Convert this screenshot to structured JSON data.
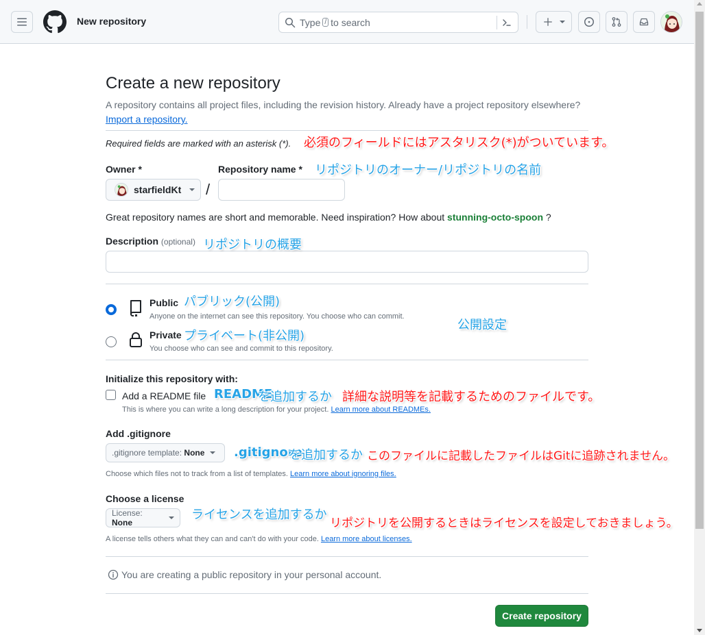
{
  "header": {
    "context_title": "New repository",
    "search_prefix": "Type",
    "search_key": "/",
    "search_suffix": "to search"
  },
  "page": {
    "title": "Create a new repository",
    "subtitle": "A repository contains all project files, including the revision history. Already have a project repository elsewhere?",
    "import_link": "Import a repository.",
    "required_note": "Required fields are marked with an asterisk (*)."
  },
  "owner": {
    "label": "Owner *",
    "value": "starfieldKt"
  },
  "repo_name": {
    "label": "Repository name *",
    "value": "",
    "placeholder": ""
  },
  "name_hint": {
    "text": "Great repository names are short and memorable. Need inspiration? How about",
    "suggestion": "stunning-octo-spoon",
    "suffix": "?"
  },
  "description": {
    "label": "Description",
    "optional": "(optional)",
    "value": ""
  },
  "visibility": {
    "public_title": "Public",
    "public_desc": "Anyone on the internet can see this repository. You choose who can commit.",
    "private_title": "Private",
    "private_desc": "You choose who can see and commit to this repository.",
    "selected": "public"
  },
  "init": {
    "heading": "Initialize this repository with:",
    "readme_label": "Add a README file",
    "readme_desc": "This is where you can write a long description for your project.",
    "readme_link": "Learn more about READMEs."
  },
  "gitignore": {
    "heading": "Add .gitignore",
    "select_prefix": ".gitignore template:",
    "select_value": "None",
    "desc": "Choose which files not to track from a list of templates.",
    "link": "Learn more about ignoring files."
  },
  "license": {
    "heading": "Choose a license",
    "select_prefix": "License:",
    "select_value": "None",
    "desc": "A license tells others what they can and can't do with your code.",
    "link": "Learn more about licenses."
  },
  "info": "You are creating a public repository in your personal account.",
  "submit_label": "Create repository",
  "annotations": {
    "required": "必須のフィールドにはアスタリスク(*)がついています。",
    "owner_repo": "リポジトリのオーナー/リポジトリの名前",
    "description": "リポジトリの概要",
    "public": "パブリック(公開)",
    "private": "プライベート(非公開)",
    "visibility": "公開設定",
    "readme_a": "README",
    "readme_b": "を追加するか",
    "readme_c": "詳細な説明等を記載するためのファイルです。",
    "gitignore_a": ".gitignore",
    "gitignore_b": "を追加するか",
    "gitignore_c": "このファイルに記載したファイルはGitに追跡されません。",
    "license_a": "ライセンスを追加するか",
    "license_b": "リポジトリを公開するときはライセンスを設定しておきましょう。"
  },
  "colors": {
    "accent": "#0969da",
    "primary_button": "#1f883d",
    "annotation_red": "#ff1a1a",
    "annotation_blue": "#27a3e6"
  }
}
